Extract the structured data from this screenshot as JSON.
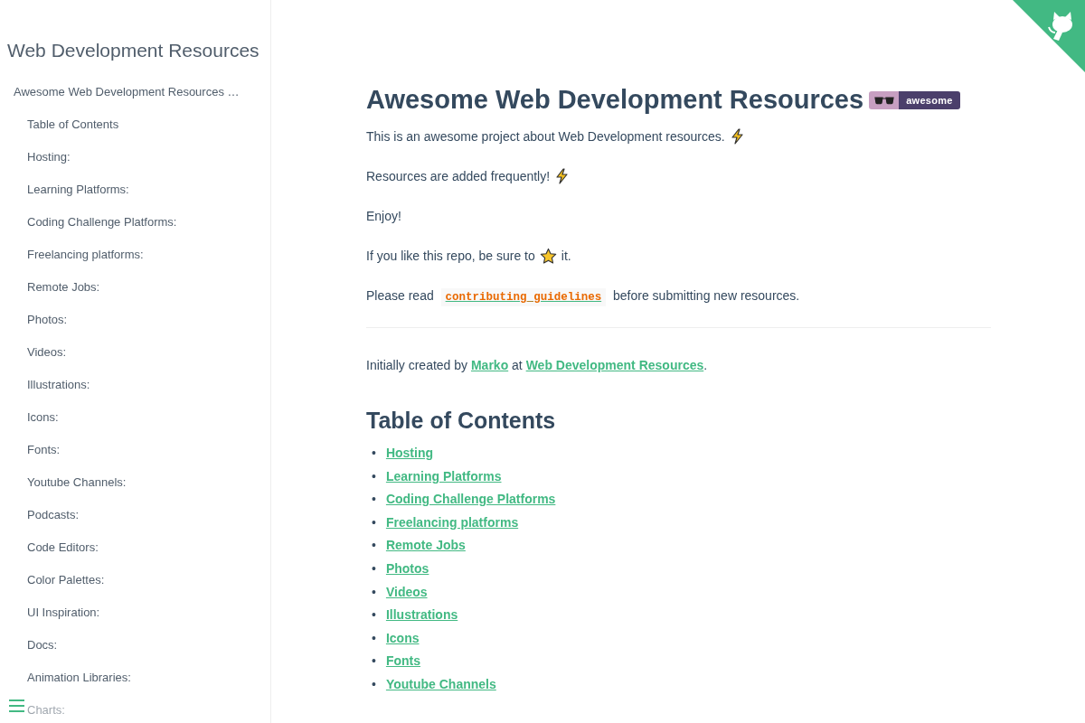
{
  "sidebar": {
    "title": "Web Development Resources",
    "items": [
      {
        "label": "Awesome Web Development Resources …",
        "children": [
          {
            "label": "Table of Contents"
          },
          {
            "label": "Hosting:"
          },
          {
            "label": "Learning Platforms:"
          },
          {
            "label": "Coding Challenge Platforms:"
          },
          {
            "label": "Freelancing platforms:"
          },
          {
            "label": "Remote Jobs:"
          },
          {
            "label": "Photos:"
          },
          {
            "label": "Videos:"
          },
          {
            "label": "Illustrations:"
          },
          {
            "label": "Icons:"
          },
          {
            "label": "Fonts:"
          },
          {
            "label": "Youtube Channels:"
          },
          {
            "label": "Podcasts:"
          },
          {
            "label": "Code Editors:"
          },
          {
            "label": "Color Palettes:"
          },
          {
            "label": "UI Inspiration:"
          },
          {
            "label": "Docs:"
          },
          {
            "label": "Animation Libraries:"
          },
          {
            "label": "Charts:"
          }
        ]
      }
    ]
  },
  "article": {
    "title": "Awesome Web Development Resources",
    "badge": "awesome",
    "paragraphs": [
      {
        "kind": "lightning",
        "before": "This is an awesome project about Web Development resources."
      },
      {
        "kind": "lightning",
        "before": "Resources are added frequently!"
      },
      {
        "kind": "text",
        "before": "Enjoy!"
      },
      {
        "kind": "star",
        "before": "If you like this repo, be sure to",
        "after": "it."
      },
      {
        "kind": "code_link",
        "before": "Please read",
        "link": "contributing_guidelines",
        "after": "before submitting new resources."
      }
    ],
    "credit": {
      "before": "Initially created by",
      "link_1": "Marko",
      "middle": "at",
      "link_2": "Web Development Resources",
      "after": "."
    },
    "toc_title": "Table of Contents",
    "toc": [
      {
        "marker": "•",
        "label": "Hosting"
      },
      {
        "marker": "•",
        "label": "Learning Platforms"
      },
      {
        "marker": "•",
        "label": "Coding Challenge Platforms"
      },
      {
        "marker": "•",
        "label": "Freelancing platforms"
      },
      {
        "marker": "•",
        "label": "Remote Jobs"
      },
      {
        "marker": "•",
        "label": "Photos"
      },
      {
        "marker": "•",
        "label": "Videos"
      },
      {
        "marker": "•",
        "label": "Illustrations"
      },
      {
        "marker": "•",
        "label": "Icons"
      },
      {
        "marker": "•",
        "label": "Fonts"
      },
      {
        "marker": "•",
        "label": "Youtube Channels"
      }
    ]
  }
}
